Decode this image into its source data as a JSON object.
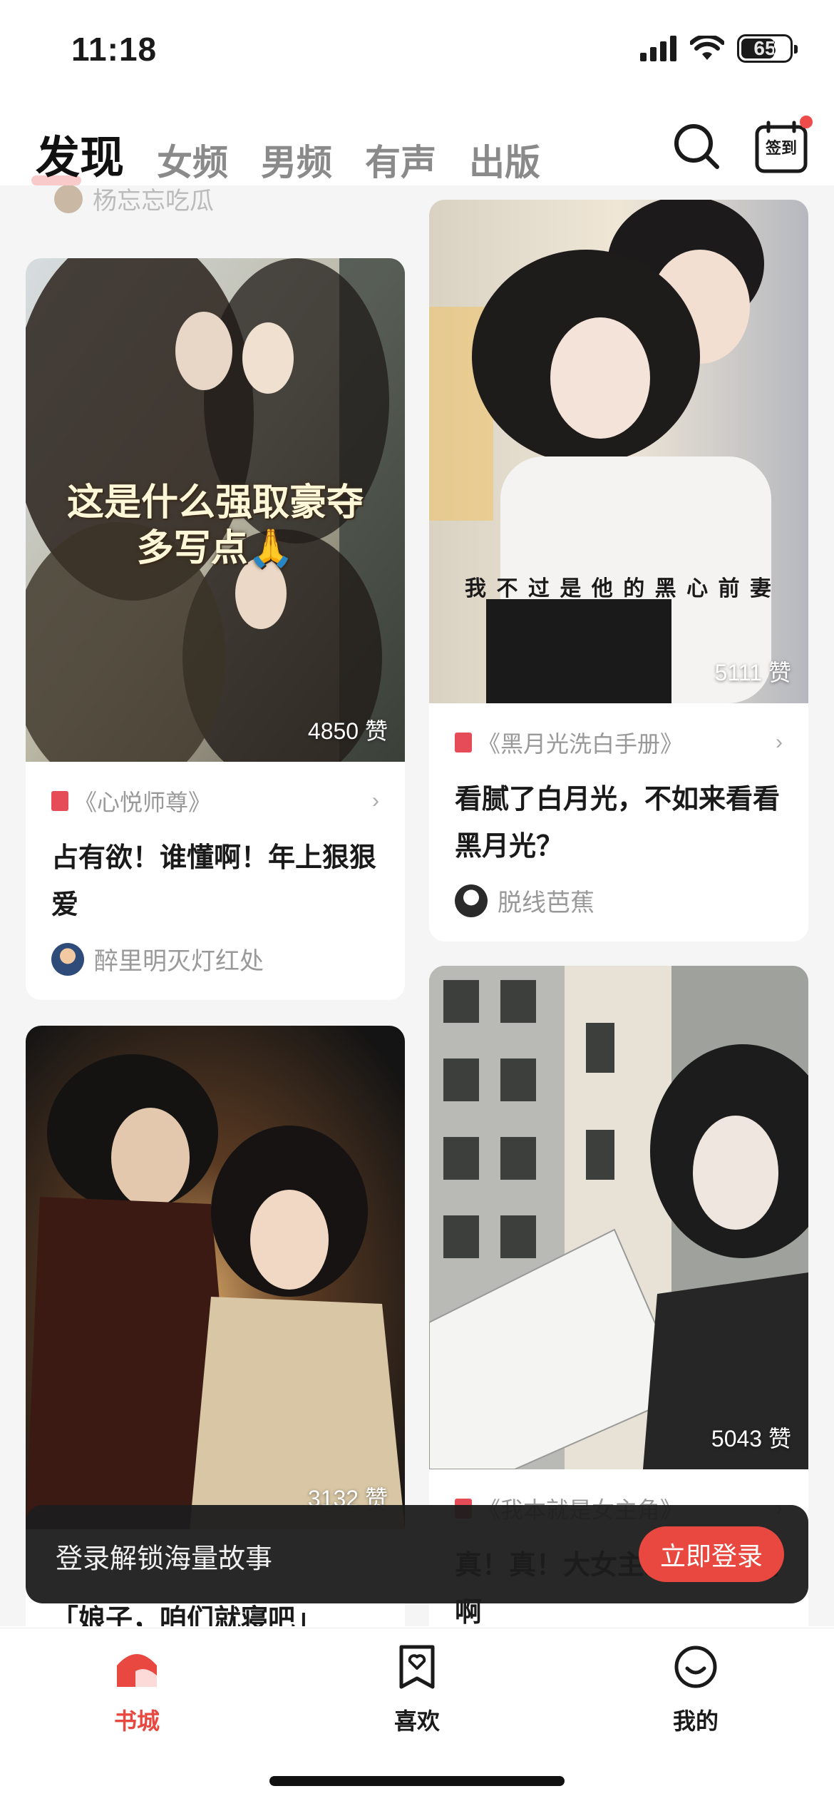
{
  "status_bar": {
    "time": "11:18",
    "battery": "65"
  },
  "header": {
    "tabs": [
      {
        "label": "发现",
        "active": true
      },
      {
        "label": "女频",
        "active": false
      },
      {
        "label": "男频",
        "active": false
      },
      {
        "label": "有声",
        "active": false
      },
      {
        "label": "出版",
        "active": false
      }
    ],
    "checkin_label": "签到"
  },
  "feed": {
    "partial_top_author": "杨忘忘吃瓜",
    "cards": [
      {
        "overlay_lines": [
          "这是什么强取豪夺",
          "多写点🙏"
        ],
        "likes": "4850 赞",
        "book": "《心悦师尊》",
        "title": "占有欲！谁懂啊！年上狠狠爱",
        "author": "醉里明灭灯红处"
      },
      {
        "overlay_lines": [
          "我 不 过 是 他 的 黑 心 前 妻"
        ],
        "likes": "5111 赞",
        "book": "《黑月光洗白手册》",
        "title": "看腻了白月光，不如来看看黑月光？",
        "author": "脱线芭蕉"
      },
      {
        "likes": "3132 赞",
        "book": "",
        "title": "「娘子，咱们就寝吧」"
      },
      {
        "likes": "5043 赞",
        "book": "《我本就是女主角》",
        "title": "真！真！大女主必看啊啊啊啊"
      }
    ]
  },
  "login_banner": {
    "text": "登录解锁海量故事",
    "button": "立即登录"
  },
  "bottom_nav": {
    "items": [
      {
        "label": "书城",
        "active": true,
        "icon": "home-icon"
      },
      {
        "label": "喜欢",
        "active": false,
        "icon": "heart-bookmark-icon"
      },
      {
        "label": "我的",
        "active": false,
        "icon": "profile-smile-icon"
      }
    ]
  },
  "colors": {
    "accent": "#e8483f",
    "book_icon": "#e64c57"
  }
}
